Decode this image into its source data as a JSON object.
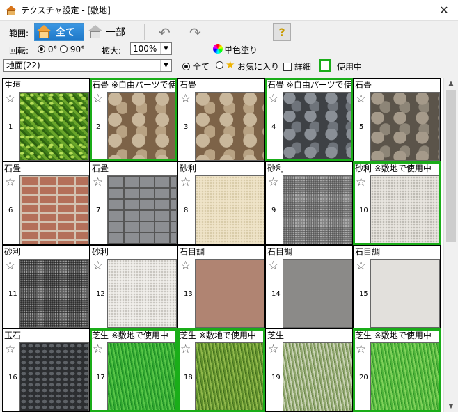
{
  "window": {
    "title": "テクスチャ設定 - [敷地]",
    "close_glyph": "✕"
  },
  "toolbar": {
    "range_label": "範囲:",
    "all_label": "全て",
    "part_label": "一部",
    "undo_glyph": "↶",
    "redo_glyph": "↷",
    "help_glyph": "?",
    "rotation_label": "回転:",
    "rotation_options": [
      "0°",
      "90°"
    ],
    "rotation_selected": "0°",
    "zoom_label": "拡大:",
    "zoom_value": "100%",
    "solid_color_label": "単色塗り"
  },
  "filter": {
    "category_value": "地面(22)",
    "all_label": "全て",
    "favorites_label": "お気に入り",
    "detail_label": "詳細",
    "in_use_label": "使用中",
    "selected": "全て"
  },
  "colors": {
    "in_use_border": "#1aad19",
    "accent": "#1f78c8"
  },
  "textures": [
    {
      "num": "1",
      "name": "生垣",
      "used": false,
      "pattern": "hedge"
    },
    {
      "num": "2",
      "name": "石畳 ※自由パーツで使",
      "used": true,
      "pattern": "stone-warm"
    },
    {
      "num": "3",
      "name": "石畳",
      "used": false,
      "pattern": "stone-warm"
    },
    {
      "num": "4",
      "name": "石畳 ※自由パーツで使",
      "used": true,
      "pattern": "stone-gray"
    },
    {
      "num": "5",
      "name": "石畳",
      "used": false,
      "pattern": "stone-mix"
    },
    {
      "num": "6",
      "name": "石畳",
      "used": false,
      "pattern": "brick"
    },
    {
      "num": "7",
      "name": "石畳",
      "used": false,
      "pattern": "block"
    },
    {
      "num": "8",
      "name": "砂利",
      "used": false,
      "pattern": "sand"
    },
    {
      "num": "9",
      "name": "砂利",
      "used": false,
      "pattern": "gravel-gray"
    },
    {
      "num": "10",
      "name": "砂利 ※敷地で使用中",
      "used": true,
      "pattern": "gravel-white"
    },
    {
      "num": "11",
      "name": "砂利",
      "used": false,
      "pattern": "gravel-dark"
    },
    {
      "num": "12",
      "name": "砂利",
      "used": false,
      "pattern": "gravel-light"
    },
    {
      "num": "13",
      "name": "石目調",
      "used": false,
      "pattern": "brown"
    },
    {
      "num": "14",
      "name": "石目調",
      "used": false,
      "pattern": "gray"
    },
    {
      "num": "15",
      "name": "石目調",
      "used": false,
      "pattern": "lightgray"
    },
    {
      "num": "16",
      "name": "玉石",
      "used": false,
      "pattern": "pebble"
    },
    {
      "num": "17",
      "name": "芝生 ※敷地で使用中",
      "used": true,
      "pattern": "grass"
    },
    {
      "num": "18",
      "name": "芝生 ※敷地で使用中",
      "used": true,
      "pattern": "grass-dry"
    },
    {
      "num": "19",
      "name": "芝生",
      "used": false,
      "pattern": "grass-pale"
    },
    {
      "num": "20",
      "name": "芝生 ※敷地で使用中",
      "used": true,
      "pattern": "grass-bright"
    }
  ],
  "scrollbar": {
    "up_glyph": "▲",
    "down_glyph": "▼"
  },
  "icons": [
    "app-house-icon",
    "undo-icon",
    "redo-icon",
    "help-icon",
    "color-wheel-icon",
    "star-icon",
    "favorite-star-icon"
  ]
}
